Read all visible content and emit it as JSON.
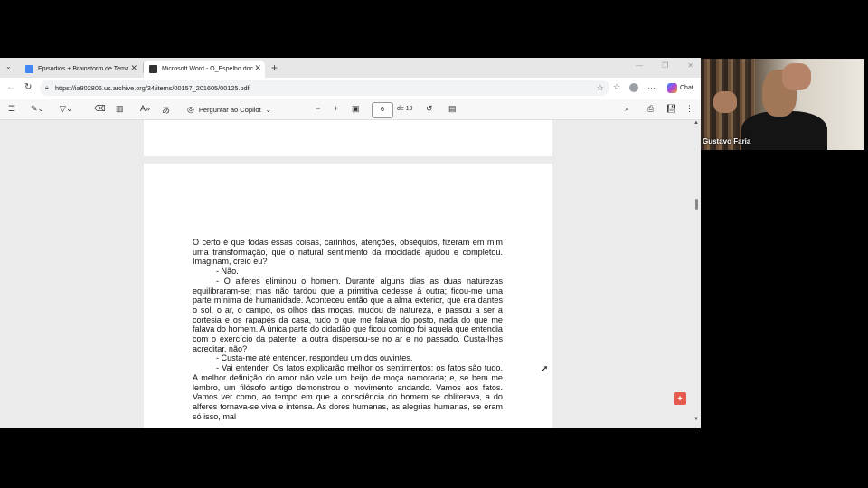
{
  "browser": {
    "tabs": [
      {
        "title": "Episódios + Brainstorm de Temas",
        "active": false,
        "icon": "docs-icon",
        "color": "#4285f4"
      },
      {
        "title": "Microsoft Word - O_Espelho.doc",
        "active": true,
        "icon": "pdf-icon",
        "color": "#333333"
      }
    ],
    "url": "https://ia802806.us.archive.org/34/items/00157_201605/00125.pdf",
    "chat_label": "Chat"
  },
  "pdf_toolbar": {
    "copilot_label": "Perguntar ao Copilot",
    "current_page": "6",
    "page_count": "de 19"
  },
  "document": {
    "paragraphs": [
      {
        "indent": false,
        "text": "O certo é que todas essas coisas, carinhos, atenções, obséquios, fizeram em mim uma transformação, que o natural sentimento da mocidade ajudou e completou. Imaginam, creio eu?"
      },
      {
        "indent": true,
        "text": "- Não."
      },
      {
        "indent": true,
        "text": "- O alferes eliminou o homem. Durante alguns dias as duas naturezas equilibraram-se; mas não tardou que a primitiva cedesse à outra; ficou-me uma parte mínima de humanidade. Aconteceu então que a alma exterior, que era dantes o sol, o ar, o campo, os olhos das moças, mudou de natureza, e passou a ser a cortesia e os rapapés da casa, tudo o que me falava do posto, nada do que me falava do homem. A única parte do cidadão que ficou comigo foi aquela que entendia com o exercício da patente; a outra dispersou-se no ar e no passado. Custa-lhes acreditar, não?"
      },
      {
        "indent": true,
        "text": "- Custa-me até entender, respondeu um dos ouvintes."
      },
      {
        "indent": true,
        "text": "- Vai entender. Os fatos explicarão melhor os sentimentos: os fatos são tudo. A melhor definição do amor não vale um beijo de moça namorada; e, se bem me lembro, um filósofo antigo demonstrou o movimento andando. Vamos aos fatos. Vamos ver como, ao tempo em que a consciência do homem se obliterava, a do alferes tornava-se viva e intensa. As dores humanas, as alegrias humanas, se eram só isso, mal"
      }
    ]
  },
  "video": {
    "participant_name": "Gustavo Faria"
  }
}
